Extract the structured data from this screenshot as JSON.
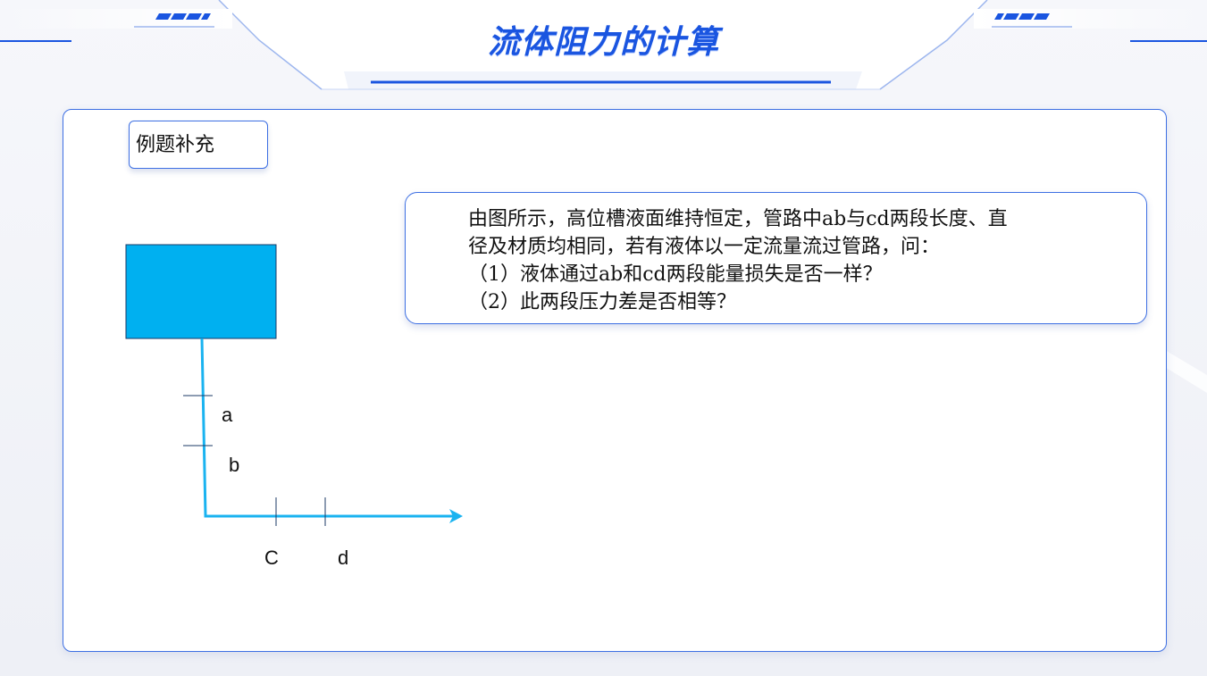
{
  "header": {
    "title": "流体阻力的计算"
  },
  "example": {
    "label": "例题补充"
  },
  "question": {
    "lines": [
      "由图所示，高位槽液面维持恒定，管路中ab与cd两段长度、直",
      "径及材质均相同，若有液体以一定流量流过管路，问：",
      "（1）液体通过ab和cd两段能量损失是否一样？",
      "（2）此两段压力差是否相等？"
    ]
  },
  "diagram": {
    "labels": {
      "a": "a",
      "b": "b",
      "c": "C",
      "d": "d"
    },
    "colors": {
      "tank": "#00b0f0",
      "pipe": "#1ab3f0",
      "accent": "#1a55e0"
    }
  }
}
